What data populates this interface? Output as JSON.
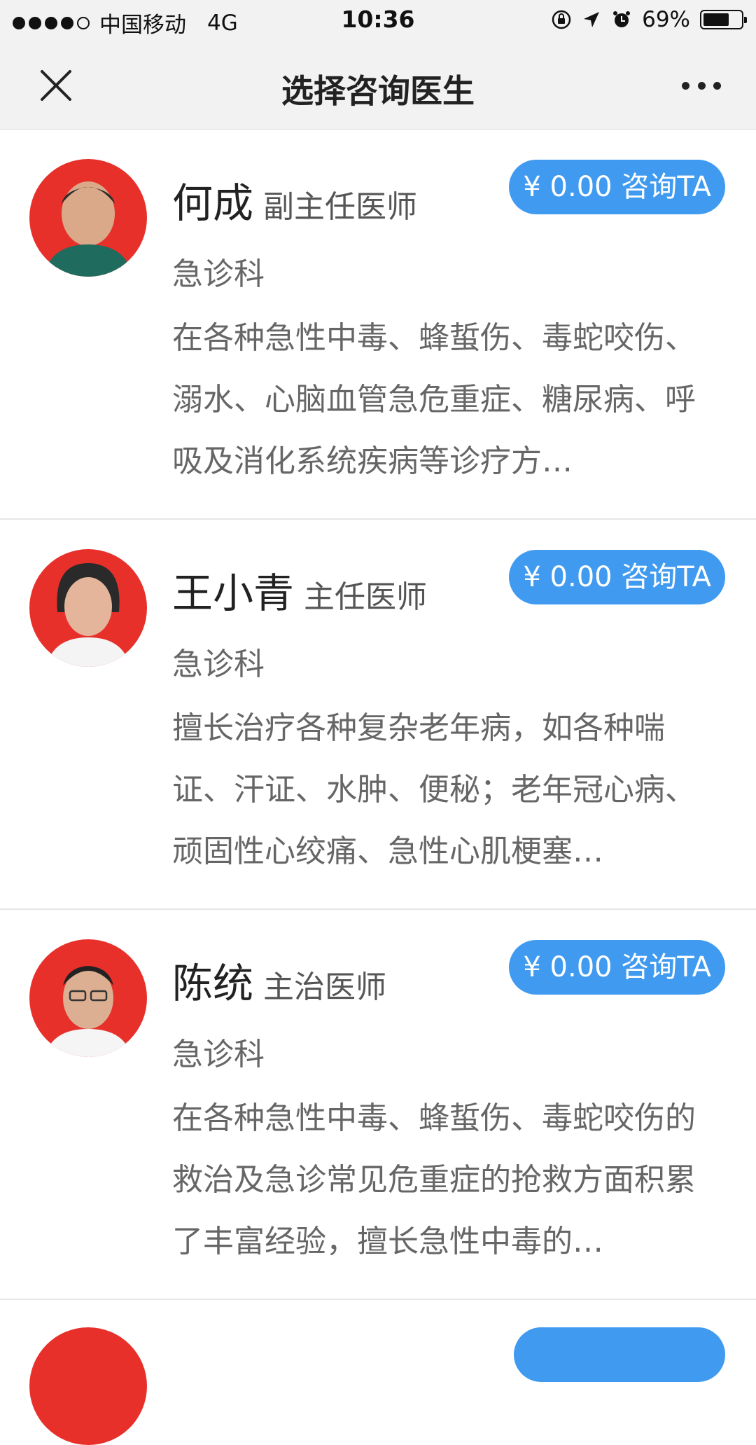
{
  "status_bar": {
    "carrier": "中国移动",
    "network": "4G",
    "time": "10:36",
    "battery": "69%",
    "battery_level": 0.69
  },
  "nav": {
    "title": "选择咨询医生"
  },
  "doctors": [
    {
      "name": "何成",
      "title": "副主任医师",
      "department": "急诊科",
      "button": "¥ 0.00 咨询TA",
      "description": "在各种急性中毒、蜂蜇伤、毒蛇咬伤、溺水、心脑血管急危重症、糖尿病、呼吸及消化系统疾病等诊疗方…"
    },
    {
      "name": "王小青",
      "title": "主任医师",
      "department": "急诊科",
      "button": "¥ 0.00 咨询TA",
      "description": "擅长治疗各种复杂老年病，如各种喘证、汗证、水肿、便秘；老年冠心病、顽固性心绞痛、急性心肌梗塞…"
    },
    {
      "name": "陈统",
      "title": "主治医师",
      "department": "急诊科",
      "button": "¥ 0.00 咨询TA",
      "description": "在各种急性中毒、蜂蜇伤、毒蛇咬伤的救治及急诊常见危重症的抢救方面积累了丰富经验，擅长急性中毒的…"
    }
  ],
  "colors": {
    "accent": "#3f9af0",
    "avatar_bg": "#e8302b",
    "nav_bg": "#f2f2f2"
  }
}
